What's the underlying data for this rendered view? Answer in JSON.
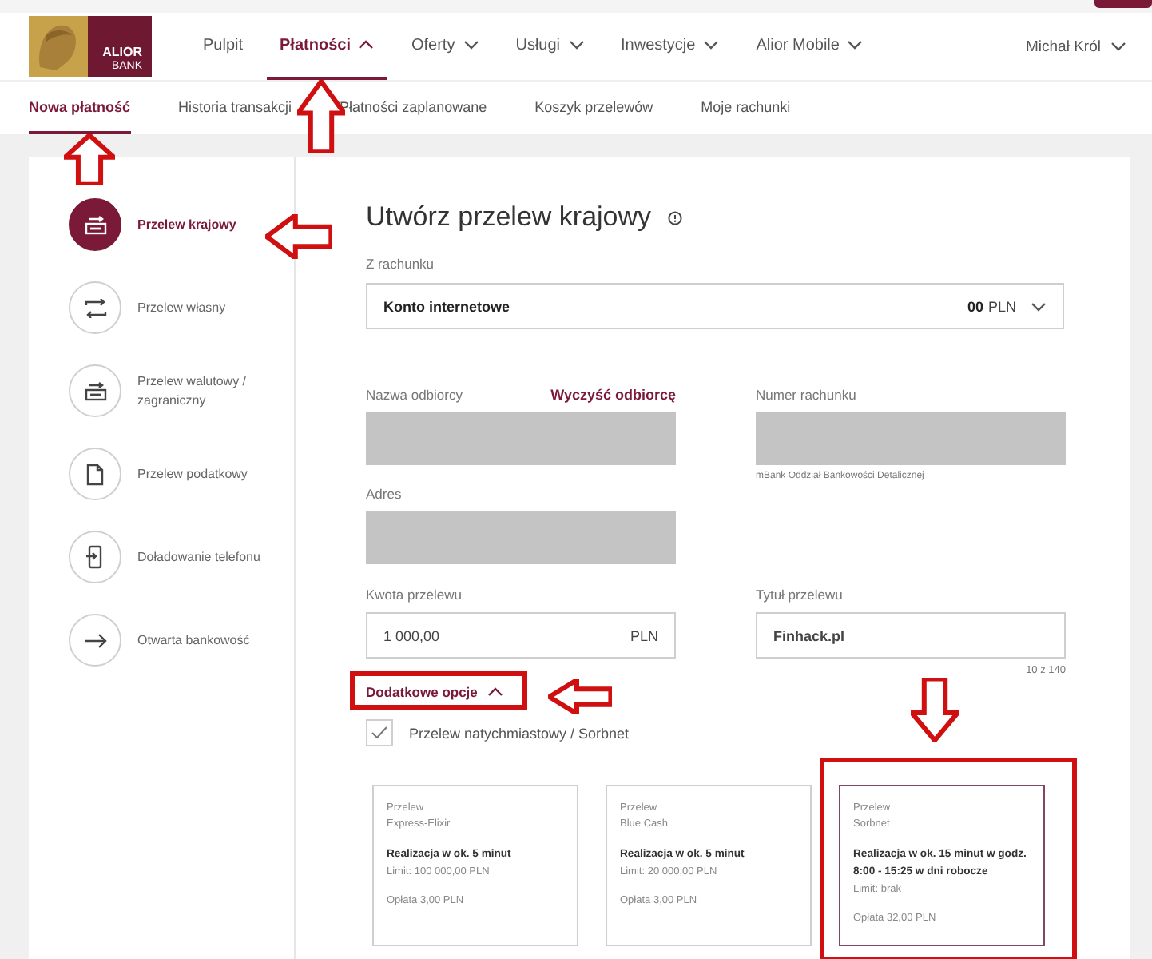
{
  "logo": {
    "line1": "ALIOR",
    "line2": "BANK"
  },
  "nav": [
    {
      "label": "Pulpit",
      "selected": false,
      "dropdown": false
    },
    {
      "label": "Płatności",
      "selected": true,
      "dropdown": true
    },
    {
      "label": "Oferty",
      "selected": false,
      "dropdown": true
    },
    {
      "label": "Usługi",
      "selected": false,
      "dropdown": true
    },
    {
      "label": "Inwestycje",
      "selected": false,
      "dropdown": true
    },
    {
      "label": "Alior Mobile",
      "selected": false,
      "dropdown": true
    }
  ],
  "user": "Michał Król",
  "subnav": [
    {
      "label": "Nowa płatność",
      "selected": true
    },
    {
      "label": "Historia transakcji",
      "selected": false
    },
    {
      "label": "Płatności zaplanowane",
      "selected": false
    },
    {
      "label": "Koszyk przelewów",
      "selected": false
    },
    {
      "label": "Moje rachunki",
      "selected": false
    }
  ],
  "sidebar": [
    {
      "label": "Przelew krajowy",
      "kind": "domestic",
      "selected": true
    },
    {
      "label": "Przelew własny",
      "kind": "own",
      "selected": false
    },
    {
      "label": "Przelew walutowy / zagraniczny",
      "kind": "foreign",
      "selected": false
    },
    {
      "label": "Przelew podatkowy",
      "kind": "tax",
      "selected": false
    },
    {
      "label": "Doładowanie telefonu",
      "kind": "phone",
      "selected": false
    },
    {
      "label": "Otwarta bankowość",
      "kind": "open",
      "selected": false
    }
  ],
  "form": {
    "title": "Utwórz przelew krajowy",
    "from_label": "Z rachunku",
    "account": "Konto internetowe",
    "balance_amount": "00",
    "balance_currency": "PLN",
    "recipient_label": "Nazwa odbiorcy",
    "clear_link": "Wyczyść odbiorcę",
    "account_number_label": "Numer rachunku",
    "bank_note": "mBank Oddział Bankowości Detalicznej",
    "address_label": "Adres",
    "amount_label": "Kwota przelewu",
    "amount": "1 000,00",
    "amount_currency": "PLN",
    "title_label": "Tytuł przelewu",
    "transfer_title": "Finhack.pl",
    "title_counter": "10 z 140",
    "options_label": "Dodatkowe opcje",
    "options_expanded": true,
    "instant": {
      "label": "Przelew natychmiastowy / Sorbnet",
      "checked": true
    }
  },
  "transfer_types": [
    {
      "line1": "Przelew",
      "line2": "Express-Elixir",
      "time": "Realizacja w ok. 5 minut",
      "limit": "Limit: 100 000,00 PLN",
      "fee": "Opłata 3,00 PLN",
      "selected": false
    },
    {
      "line1": "Przelew",
      "line2": "Blue Cash",
      "time": "Realizacja w ok. 5 minut",
      "limit": "Limit: 20 000,00 PLN",
      "fee": "Opłata 3,00 PLN",
      "selected": false
    },
    {
      "line1": "Przelew",
      "line2": "Sorbnet",
      "time": "Realizacja w ok. 15 minut w godz. 8:00 - 15:25 w dni robocze",
      "limit": "Limit: brak",
      "fee": "Opłata 32,00 PLN",
      "selected": true
    }
  ]
}
